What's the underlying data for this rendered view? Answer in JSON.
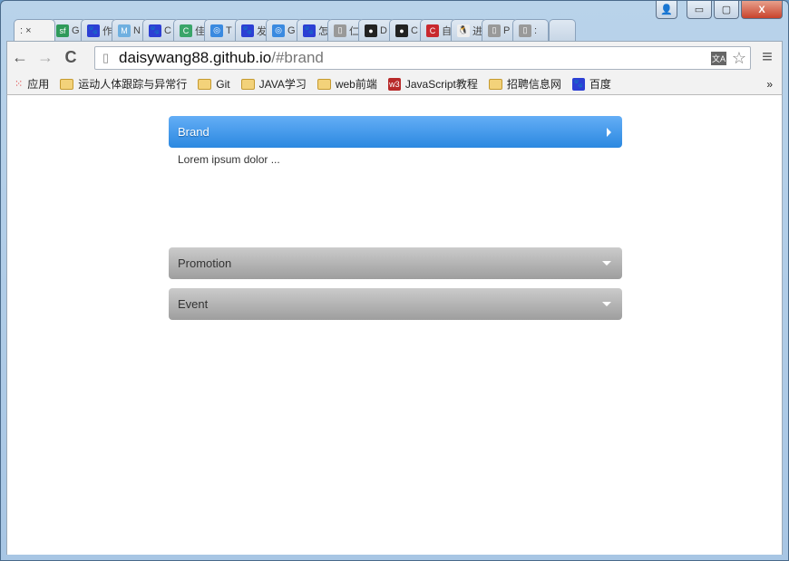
{
  "window": {
    "minimize": "▭",
    "maximize": "▢",
    "close": "X",
    "profile": "👤"
  },
  "tabs": [
    {
      "label": ": ×",
      "icon": "none",
      "color": "",
      "active": true
    },
    {
      "label": "G",
      "icon": "sf",
      "color": "#2e9a5a"
    },
    {
      "label": "作",
      "icon": "🐾",
      "color": "#2c3fd4"
    },
    {
      "label": "N",
      "icon": "M",
      "color": "#6fb0e0"
    },
    {
      "label": "C",
      "icon": "🐾",
      "color": "#2c3fd4"
    },
    {
      "label": "佳",
      "icon": "C",
      "color": "#3aa56a"
    },
    {
      "label": "T",
      "icon": "◎",
      "color": "#3a8ae0"
    },
    {
      "label": "发",
      "icon": "🐾",
      "color": "#2c3fd4"
    },
    {
      "label": "G",
      "icon": "◎",
      "color": "#3a8ae0"
    },
    {
      "label": "怎",
      "icon": "🐾",
      "color": "#2c3fd4"
    },
    {
      "label": "仁",
      "icon": "▯",
      "color": "#999"
    },
    {
      "label": "D",
      "icon": "●",
      "color": "#222"
    },
    {
      "label": "C",
      "icon": "●",
      "color": "#222"
    },
    {
      "label": "自",
      "icon": "C",
      "color": "#c8282e"
    },
    {
      "label": "进",
      "icon": "🐧",
      "color": "#eee"
    },
    {
      "label": "P",
      "icon": "▯",
      "color": "#999"
    },
    {
      "label": ":",
      "icon": "▯",
      "color": "#999"
    }
  ],
  "toolbar": {
    "back": "←",
    "forward": "→",
    "reload": "C",
    "url_host": "daisywang88.github.io",
    "url_path": "/#brand",
    "menu": "≡",
    "star": "☆",
    "translate": "文A"
  },
  "bookmarks": {
    "apps": "应用",
    "items": [
      {
        "label": "运动人体跟踪与异常行",
        "icon": "folder"
      },
      {
        "label": "Git",
        "icon": "folder"
      },
      {
        "label": "JAVA学习",
        "icon": "folder"
      },
      {
        "label": "web前端",
        "icon": "folder"
      },
      {
        "label": "JavaScript教程",
        "icon": "w3"
      },
      {
        "label": "招聘信息网",
        "icon": "folder"
      },
      {
        "label": "百度",
        "icon": "baidu"
      }
    ],
    "more": "»"
  },
  "accordion": [
    {
      "title": "Brand",
      "expanded": true,
      "content": "Lorem ipsum dolor ..."
    },
    {
      "title": "Promotion",
      "expanded": false
    },
    {
      "title": "Event",
      "expanded": false
    }
  ],
  "colors": {
    "active_header": "#2b88e0",
    "inactive_header": "#a8a8a8"
  }
}
